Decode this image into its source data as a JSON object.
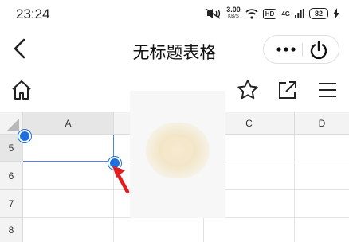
{
  "status_bar": {
    "time": "23:24",
    "net_speed_value": "3.00",
    "net_speed_unit": "KB/S",
    "hd": "HD",
    "signal": "4G",
    "battery": "82"
  },
  "header": {
    "title": "无标题表格"
  },
  "spreadsheet": {
    "columns": [
      "A",
      "C",
      "D"
    ],
    "rows": [
      "5",
      "6",
      "7",
      "8"
    ]
  },
  "colors": {
    "accent": "#1e6fe0",
    "arrow": "#e02020",
    "selection": "#4a86e8"
  }
}
